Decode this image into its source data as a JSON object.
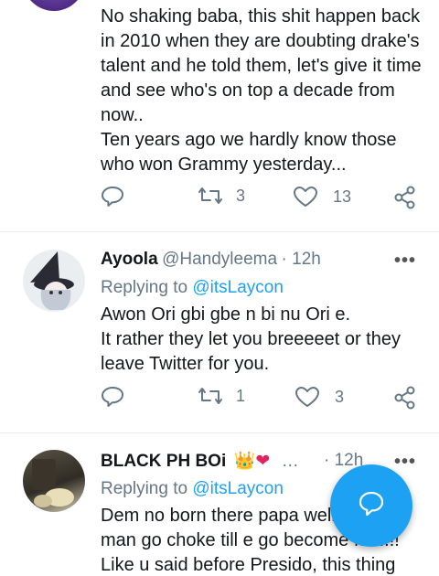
{
  "tweet1": {
    "text": "No shaking baba,  this shit happen back in 2010 when they  are doubting drake's talent and he told them,  let's give it time and see who's on top a decade from now..\nTen years ago we hardly know those who won Grammy yesterday...",
    "retweets": "3",
    "likes": "13"
  },
  "tweet2": {
    "name": "Ayoola",
    "handle": "@Handyleema",
    "time": "· 12h",
    "replying_label": "Replying to",
    "replying_to": "@itsLaycon",
    "text": "Awon Ori gbi gbe n bi nu Ori e.\nIt rather they let you breeeeet or they leave Twitter for you.",
    "retweets": "1",
    "likes": "3"
  },
  "tweet3": {
    "name": "BLACK PH BOi",
    "emoji": "👑❤",
    "ellipsis": "…",
    "time": "· 12h",
    "replying_label": "Replying to",
    "replying_to": "@itsLaycon",
    "text": "Dem no born there papa well\nman go choke till e go become fan!!!!\nLike u said before Presido, this thing"
  },
  "more_icon": "•••",
  "colors": {
    "accent": "#1da1f2",
    "muted": "#657786",
    "text": "#14171a",
    "divider": "#e6ecf0",
    "heart": "#e0245e"
  }
}
